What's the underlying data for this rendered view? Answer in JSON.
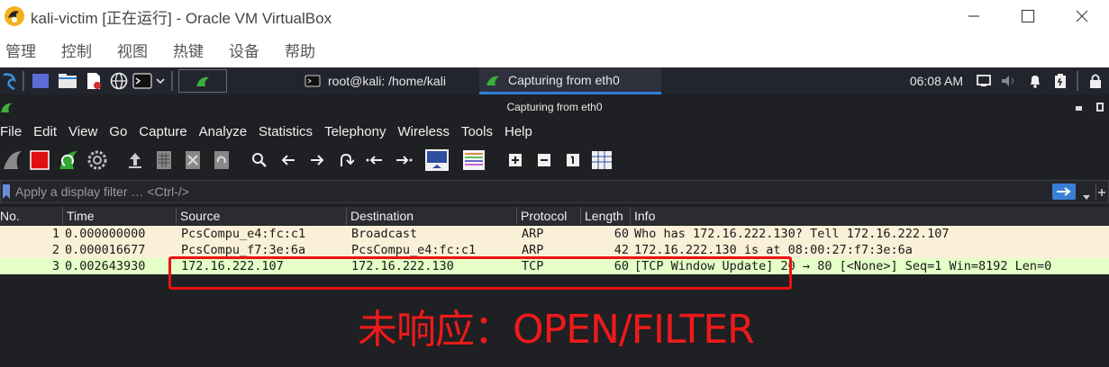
{
  "vbox": {
    "title": "kali-victim [正在运行] - Oracle VM VirtualBox",
    "menu": [
      "管理",
      "控制",
      "视图",
      "热键",
      "设备",
      "帮助"
    ]
  },
  "kali_panel": {
    "tasks": [
      {
        "label": "root@kali: /home/kali",
        "icon": "terminal-icon"
      },
      {
        "label": "Capturing from eth0",
        "icon": "wireshark-fin-icon"
      }
    ],
    "clock": "06:08 AM"
  },
  "wireshark": {
    "window_title": "Capturing from eth0",
    "menu": [
      "File",
      "Edit",
      "View",
      "Go",
      "Capture",
      "Analyze",
      "Statistics",
      "Telephony",
      "Wireless",
      "Tools",
      "Help"
    ],
    "filter_placeholder": "Apply a display filter … <Ctrl-/>",
    "columns": [
      "No.",
      "Time",
      "Source",
      "Destination",
      "Protocol",
      "Length",
      "Info"
    ],
    "packets": [
      {
        "no": "1",
        "time": "0.000000000",
        "src": "PcsCompu_e4:fc:c1",
        "dst": "Broadcast",
        "proto": "ARP",
        "len": "60",
        "info": "Who has 172.16.222.130? Tell 172.16.222.107"
      },
      {
        "no": "2",
        "time": "0.000016677",
        "src": "PcsCompu_f7:3e:6a",
        "dst": "PcsCompu_e4:fc:c1",
        "proto": "ARP",
        "len": "42",
        "info": "172.16.222.130 is at 08:00:27:f7:3e:6a"
      },
      {
        "no": "3",
        "time": "0.002643930",
        "src": "172.16.222.107",
        "dst": "172.16.222.130",
        "proto": "TCP",
        "len": "60",
        "info": "[TCP Window Update] 20 → 80 [<None>] Seq=1 Win=8192 Len=0"
      }
    ]
  },
  "annotation": "未响应：OPEN/FILTER",
  "colors": {
    "arp_row": "#faf0d7",
    "tcp_row": "#e4ffc7",
    "annotation": "#ee1a1a"
  }
}
